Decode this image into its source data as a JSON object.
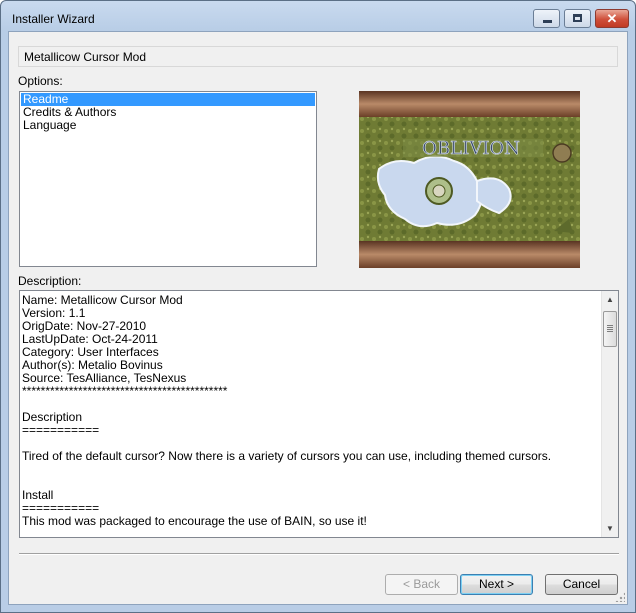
{
  "window": {
    "title": "Installer Wizard"
  },
  "header": {
    "mod_name": "Metallicow Cursor Mod"
  },
  "options": {
    "label": "Options:",
    "items": [
      {
        "label": "Readme",
        "selected": true
      },
      {
        "label": "Credits & Authors",
        "selected": false
      },
      {
        "label": "Language",
        "selected": false
      }
    ]
  },
  "preview": {
    "map_title": "OBLIVION",
    "colors": {
      "frame": "#8a5a3b",
      "land": "#7d8a3a",
      "water": "#c9d8ee"
    }
  },
  "description": {
    "label": "Description:",
    "lines": [
      "Name: Metallicow Cursor Mod",
      "Version: 1.1",
      "OrigDate: Nov-27-2010",
      "LastUpDate: Oct-24-2011",
      "Category: User Interfaces",
      "Author(s): Metalio Bovinus",
      "Source: TesAlliance, TesNexus",
      "********************************************",
      "",
      "Description",
      "===========",
      "",
      "Tired of the default cursor? Now there is a variety of cursors you can use, including themed cursors.",
      "",
      "",
      "Install",
      "===========",
      "This mod was packaged to encourage the use of BAIN, so use it!"
    ]
  },
  "buttons": {
    "back": "< Back",
    "next": "Next >",
    "cancel": "Cancel"
  },
  "caption_buttons": {
    "minimize": "minimize-icon",
    "maximize": "maximize-icon",
    "close": "close-icon"
  }
}
